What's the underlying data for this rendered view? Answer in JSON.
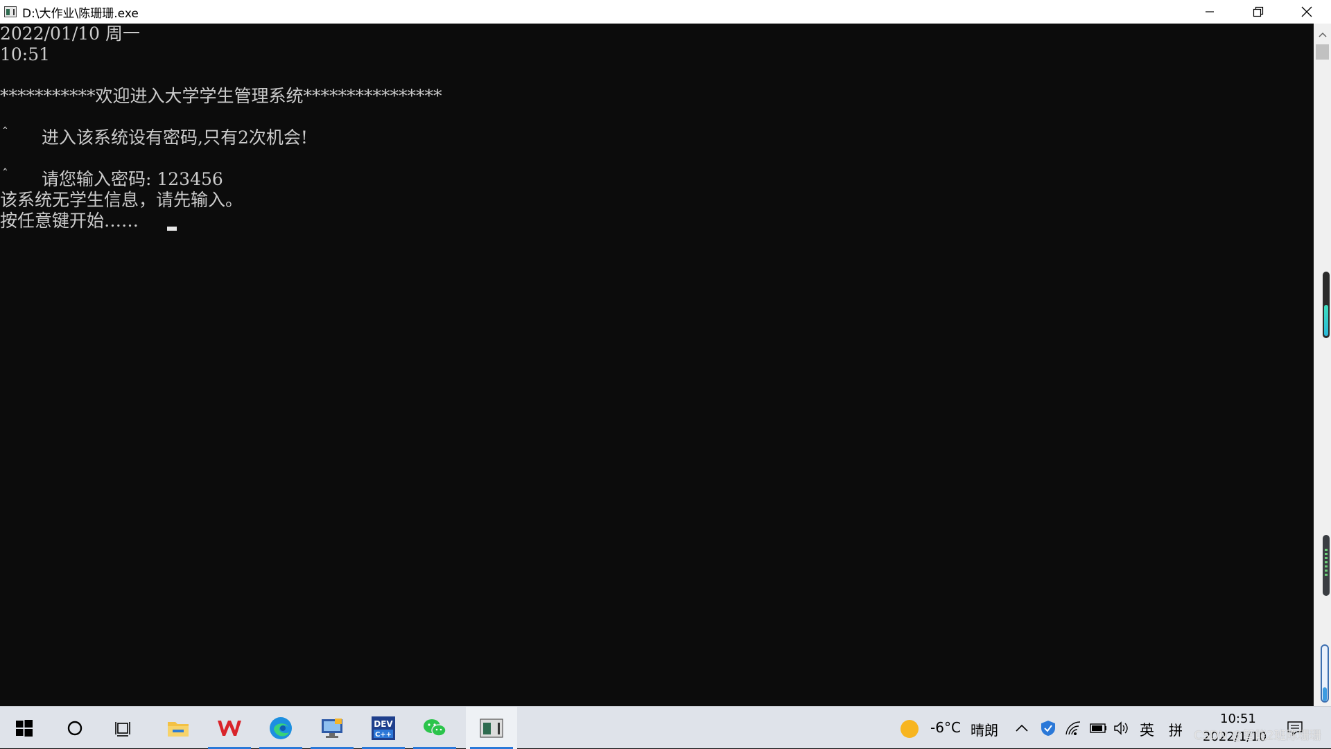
{
  "window": {
    "title": "D:\\大作业\\陈珊珊.exe",
    "minimize_icon": "minimize-icon",
    "restore_icon": "restore-icon",
    "close_icon": "close-icon"
  },
  "console": {
    "lines": [
      "2022/01/10 周一",
      "10:51",
      "***********欢迎进入大学学生管理系统****************",
      "进入该系统设有密码,只有2次机会!",
      "请您输入密码: 123456",
      "该系统无学生信息，请先输入。",
      "按任意键开始……"
    ],
    "prompt_mark": "ˆ"
  },
  "taskbar": {
    "apps": [
      {
        "name": "start",
        "icon": "windows-start-icon"
      },
      {
        "name": "search",
        "icon": "cortana-circle-icon"
      },
      {
        "name": "task-view",
        "icon": "task-view-icon"
      },
      {
        "name": "file-explorer",
        "icon": "folder-icon"
      },
      {
        "name": "wps",
        "icon": "wps-icon"
      },
      {
        "name": "edge",
        "icon": "edge-icon"
      },
      {
        "name": "remote-desktop",
        "icon": "computer-icon"
      },
      {
        "name": "dev-cpp",
        "icon": "dev-cpp-icon"
      },
      {
        "name": "wechat",
        "icon": "wechat-icon"
      },
      {
        "name": "console",
        "icon": "console-app-icon"
      }
    ],
    "weather": {
      "temperature": "-6°C",
      "condition": "晴朗",
      "icon": "sun-icon"
    },
    "tray": {
      "ime_lang": "英",
      "ime_mode": "拼",
      "time": "10:51",
      "date": "2022/1/10"
    },
    "watermark": "CSDN @智能2班陈珊珊",
    "accent": "#2a78d8"
  }
}
